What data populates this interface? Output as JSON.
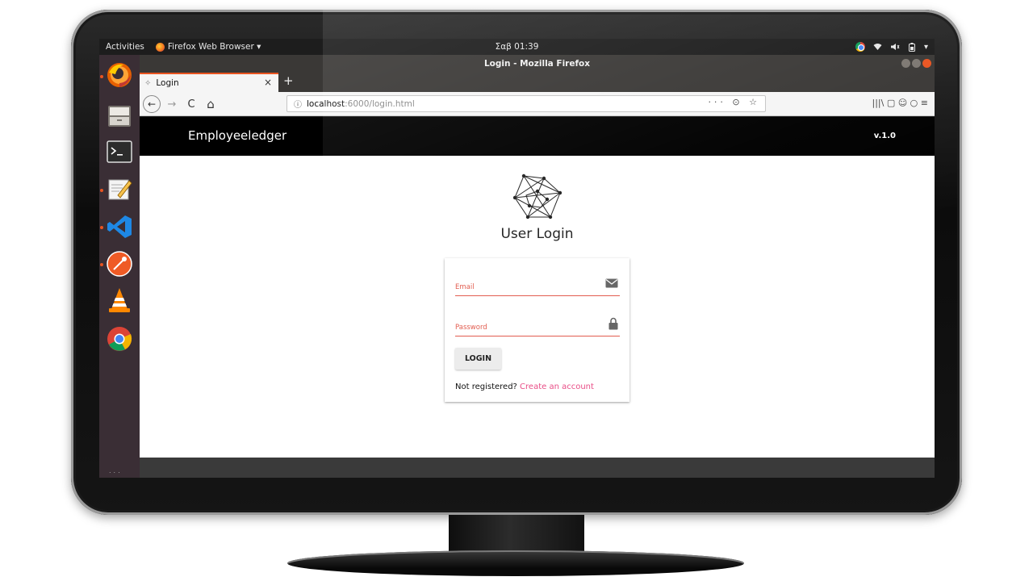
{
  "system_bar": {
    "activities": "Activities",
    "app_menu": "Firefox Web Browser ▾",
    "clock": "Σαβ 01:39",
    "status_icons": "▾"
  },
  "dock": {
    "items": [
      "firefox-icon",
      "files-icon",
      "terminal-icon",
      "text-editor-icon",
      "vscode-icon",
      "postman-icon",
      "vlc-icon",
      "chrome-icon"
    ],
    "apps_grid": "..."
  },
  "browser": {
    "window_title": "Login - Mozilla Firefox",
    "tab": {
      "title": "Login",
      "close": "×",
      "new_tab": "+"
    },
    "nav": {
      "back": "←",
      "forward": "→",
      "reload": "C",
      "home": "⌂"
    },
    "url": {
      "host": "localhost",
      "path": ":6000/login.html",
      "actions": "··· ⊙ ☆"
    },
    "right_tools": "|||\\ ▢ ☺ ○ ≡"
  },
  "page": {
    "brand": "Employeeledger",
    "version": "v.1.0",
    "login_title": "User Login",
    "email_label": "Email",
    "password_label": "Password",
    "login_button": "LOGIN",
    "register_prompt": "Not registered?",
    "register_link": "Create an account"
  },
  "colors": {
    "accent": "#e95420",
    "field_error": "#e25c4f",
    "link": "#e94e87",
    "appbar": "#000000"
  }
}
